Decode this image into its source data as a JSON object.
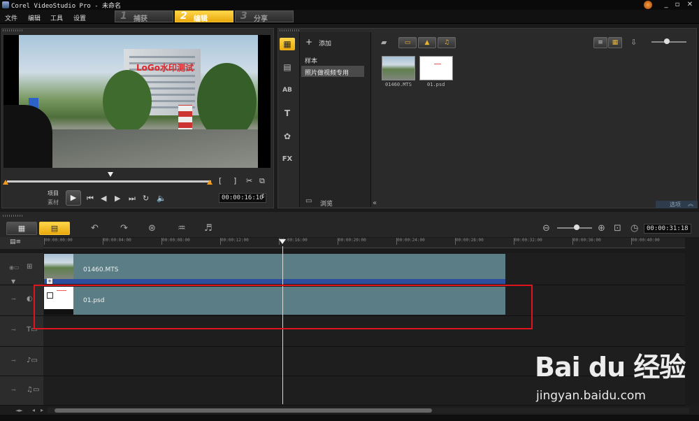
{
  "window": {
    "title": "Corel VideoStudio Pro - 未命名",
    "min_glyph": "_",
    "restore_glyph": "▫",
    "close_glyph": "✕"
  },
  "menu": {
    "items": [
      "文件",
      "编辑",
      "工具",
      "设置"
    ]
  },
  "steps": [
    {
      "num": "1",
      "label": "捕获"
    },
    {
      "num": "2",
      "label": "编辑"
    },
    {
      "num": "3",
      "label": "分享"
    }
  ],
  "preview": {
    "watermark_text": "LoGo水印测试",
    "project_label": "项目",
    "clip_label": "素材",
    "timecode": "00:00:16:10",
    "mark_in": "[",
    "mark_out": "]"
  },
  "library": {
    "add_label": "添加",
    "sample_label": "样本",
    "folder_item": "照片做视频专用",
    "browse_label": "浏览",
    "options_label": "选项",
    "thumbs": [
      {
        "label": "01460.MTS"
      },
      {
        "label": "01.psd"
      }
    ],
    "side_icons": [
      "media-icon",
      "transition-icon",
      "title-ab-icon",
      "text-icon",
      "graphic-icon",
      "filter-icon"
    ],
    "side_glyphs": [
      "▦",
      "▤",
      "AB",
      "T",
      "✿",
      "FX"
    ]
  },
  "timeline": {
    "total_time": "00:00:31:18",
    "ruler_ticks": [
      "00:00:00:00",
      "00:00:04:00",
      "00:00:08:00",
      "00:00:12:00",
      "00:00:16:00",
      "00:00:20:00",
      "00:00:24:00",
      "00:00:28:00",
      "00:00:32:00",
      "00:00:36:00",
      "00:00:40:00"
    ],
    "clips": [
      {
        "name": "01460.MTS"
      },
      {
        "name": "01.psd"
      }
    ]
  },
  "watermark": {
    "brand": "Bai du 经验",
    "url": "jingyan.baidu.com"
  },
  "colors": {
    "accent": "#f2b31c",
    "clip": "#5b7e86",
    "highlight": "#e0141c"
  }
}
